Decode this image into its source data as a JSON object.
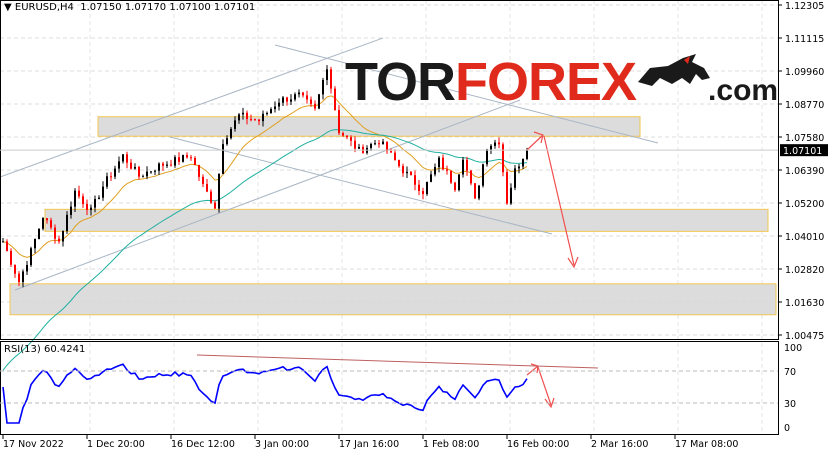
{
  "header": {
    "symbol": "EURUSD,H4",
    "open": "1.07150",
    "high": "1.07170",
    "low": "1.07100",
    "close": "1.07101"
  },
  "logo": {
    "part1": "TOR",
    "part2": "FOREX",
    "part3": ".com"
  },
  "colors": {
    "bull": "#000000",
    "bear": "#ff0000",
    "ma_fast": "#e0a020",
    "ma_slow": "#20b0a0",
    "rsi": "#0000ff",
    "zone_fill": "#d9d9d9",
    "zone_border": "#f0c040",
    "channel": "#a9b6c4",
    "arrow": "#f05050",
    "logo_red": "#e02a1c"
  },
  "chart_data": {
    "type": "candlestick",
    "symbol": "EURUSD",
    "timeframe": "H4",
    "y_ticks": [
      "1.12305",
      "1.11115",
      "1.09960",
      "1.08770",
      "1.07580",
      "1.06390",
      "1.05200",
      "1.04010",
      "1.02820",
      "1.01630",
      "1.00475"
    ],
    "ylim": [
      1.00475,
      1.12305
    ],
    "current_price": "1.07101",
    "x_ticks": [
      "17 Nov 2022",
      "1 Dec 20:00",
      "16 Dec 12:00",
      "3 Jan 00:00",
      "17 Jan 16:00",
      "1 Feb 08:00",
      "16 Feb 00:00",
      "2 Mar 16:00",
      "17 Mar 08:00"
    ],
    "close_path": [
      [
        0,
        1.0383
      ],
      [
        4,
        1.0239
      ],
      [
        7,
        1.0347
      ],
      [
        10,
        1.0473
      ],
      [
        14,
        1.0383
      ],
      [
        18,
        1.0563
      ],
      [
        22,
        1.0491
      ],
      [
        25,
        1.0581
      ],
      [
        30,
        1.069
      ],
      [
        34,
        1.0617
      ],
      [
        39,
        1.0654
      ],
      [
        47,
        1.069
      ],
      [
        50,
        1.0581
      ],
      [
        53,
        1.0509
      ],
      [
        55,
        1.0744
      ],
      [
        59,
        1.0834
      ],
      [
        64,
        1.0816
      ],
      [
        69,
        1.0888
      ],
      [
        74,
        1.0906
      ],
      [
        78,
        1.0852
      ],
      [
        81,
        1.1014
      ],
      [
        84,
        1.078
      ],
      [
        89,
        1.0708
      ],
      [
        94,
        1.0744
      ],
      [
        99,
        1.0654
      ],
      [
        105,
        1.0563
      ],
      [
        109,
        1.0672
      ],
      [
        113,
        1.0581
      ],
      [
        115,
        1.069
      ],
      [
        118,
        1.0527
      ],
      [
        121,
        1.0726
      ],
      [
        124,
        1.0744
      ],
      [
        126,
        1.0527
      ],
      [
        128,
        1.0636
      ],
      [
        131,
        1.0715
      ]
    ],
    "zones": [
      {
        "top": 1.083,
        "bottom": 1.076
      },
      {
        "top": 1.0498,
        "bottom": 1.0419
      },
      {
        "top": 1.0231,
        "bottom": 1.012
      }
    ],
    "rsi": {
      "label": "RSI(13) 60.4241",
      "period": 13,
      "value": 60.4241,
      "levels": [
        70,
        30
      ],
      "y_ticks": [
        "100",
        "70",
        "30",
        "0"
      ]
    }
  }
}
